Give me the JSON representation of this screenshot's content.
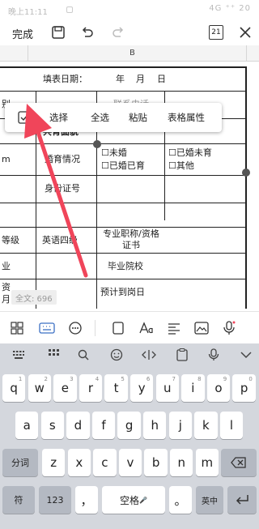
{
  "status_bar": {
    "time": "晚上11:11",
    "right": "4G ⁺⁺ 20"
  },
  "toolbar": {
    "done": "完成",
    "count": "21"
  },
  "sheet": {
    "column_b": "B",
    "cells": {
      "fill_date": "填表日期：",
      "year": "年",
      "month": "月",
      "day": "日",
      "partial_bie": "别",
      "contact_phone": "联系电话",
      "highlight_partial": "共育面貌",
      "partial_m": "m",
      "marital_status": "婚育情况",
      "opt_unmarried": "☐未婚",
      "opt_married_no_child": "☐已婚未育",
      "opt_married_child": "☐已婚已育",
      "opt_other": "☐其他",
      "id_number": "身份证号",
      "partial_level": "等级",
      "english_level": "英语四级",
      "title_cert": "专业职称/资格证书",
      "partial_ye": "业",
      "graduate_school": "毕业院校",
      "partial_zi": "资",
      "partial_yue": "月",
      "expected_date": "预计到岗日"
    },
    "word_count": "全文: 696"
  },
  "context_menu": {
    "select": "选择",
    "select_all": "全选",
    "paste": "粘贴",
    "table_props": "表格属性"
  },
  "keyboard": {
    "row1": [
      "q",
      "w",
      "e",
      "r",
      "t",
      "y",
      "u",
      "i",
      "o",
      "p"
    ],
    "row1_nums": [
      "1",
      "2",
      "3",
      "4",
      "5",
      "6",
      "7",
      "8",
      "9",
      "0"
    ],
    "row2": [
      "a",
      "s",
      "d",
      "f",
      "g",
      "h",
      "j",
      "k",
      "l"
    ],
    "row3": [
      "z",
      "x",
      "c",
      "v",
      "b",
      "n",
      "m"
    ],
    "fenci": "分词",
    "fu": "符",
    "num_key": "123",
    "comma": "，",
    "space": "空格",
    "period": "。",
    "lang": "英中"
  },
  "colors": {
    "accent": "#3b6fc4",
    "arrow": "#f0455a",
    "keyboard_bg": "#d4d7dd"
  }
}
